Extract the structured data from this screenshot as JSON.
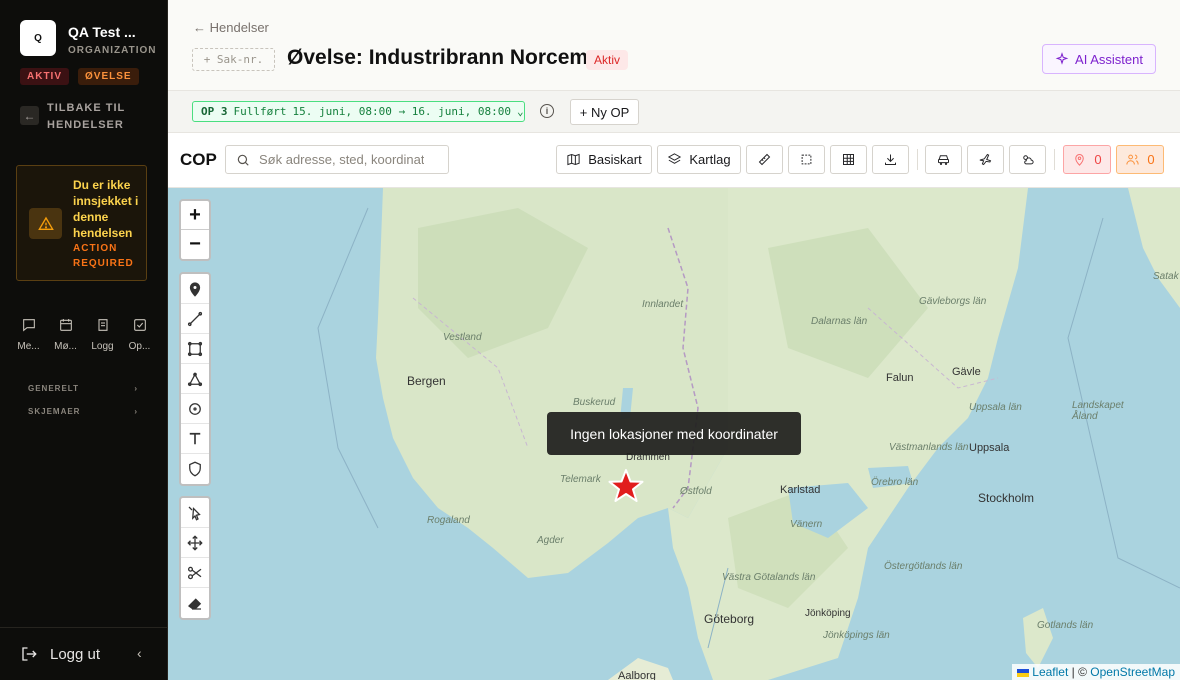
{
  "sidebar": {
    "org_logo": "Q",
    "org_name": "QA Test ...",
    "org_type": "ORGANIZATION",
    "badges": [
      "AKTIV",
      "ØVELSE"
    ],
    "back_label": "TILBAKE TIL HENDELSER",
    "warning": {
      "title": "Du er ikke innsjekket i denne hendelsen",
      "subtitle": "ACTION REQUIRED"
    },
    "nav_items": [
      {
        "label": "Me...",
        "icon": "message-icon"
      },
      {
        "label": "Mø...",
        "icon": "calendar-icon"
      },
      {
        "label": "Logg",
        "icon": "log-icon"
      },
      {
        "label": "Op...",
        "icon": "checkbox-icon"
      }
    ],
    "sections": [
      "GENERELT",
      "SKJEMAER"
    ],
    "logout_label": "Logg ut"
  },
  "header": {
    "breadcrumb": "Hendelser",
    "sak_placeholder": "+ Sak-nr.",
    "title": "Øvelse: Industribrann Norcem",
    "status": "Aktiv",
    "ai_label": "AI Assistent"
  },
  "op": {
    "code": "OP 3",
    "state": "Fullført",
    "range": "15. juni, 08:00 → 16. juni, 08:00",
    "info": "i",
    "new_label": "Ny OP"
  },
  "toolbar": {
    "cop": "COP",
    "search_placeholder": "Søk adresse, sted, koordinater...",
    "basemap_label": "Basiskart",
    "layers_label": "Kartlag",
    "pins_count": "0",
    "people_count": "0"
  },
  "map": {
    "tooltip": "Ingen lokasjoner med koordinater",
    "zoom_in": "+",
    "zoom_out": "−",
    "labels": {
      "bergen": "Bergen",
      "vestland": "Vestland",
      "innlandet": "Innlandet",
      "buskerud": "Buskerud",
      "telemark": "Telemark",
      "rogaland": "Rogaland",
      "agder": "Agder",
      "drammen": "Drammen",
      "ostfold": "Østfold",
      "karlstad": "Karlstad",
      "stockholm": "Stockholm",
      "goteborg": "Göteborg",
      "gavle": "Gävle",
      "gavleborgs": "Gävleborgs län",
      "falun": "Falun",
      "dalarnas": "Dalarnas län",
      "uppsala": "Uppsala",
      "uppsala_lan": "Uppsala län",
      "vastmanlands": "Västmanlands län",
      "orebro": "Örebro län",
      "vanern": "Vänern",
      "vastra_gotaland": "Västra Götalands län",
      "jonkoping": "Jönköping",
      "jonkopings": "Jönköpings län",
      "ostergotlands": "Östergötlands län",
      "gotlands": "Gotlands län",
      "aalborg": "Aalborg",
      "landskapet": "Landskapet Åland",
      "satak": "Satak"
    },
    "attribution": {
      "leaflet": "Leaflet",
      "sep": " | © ",
      "osm": "OpenStreetMap"
    }
  },
  "colors": {
    "accent_red": "#dc2626",
    "warning": "#fcd34d",
    "op_green": "#15803d",
    "ai_purple": "#7e22ce"
  }
}
